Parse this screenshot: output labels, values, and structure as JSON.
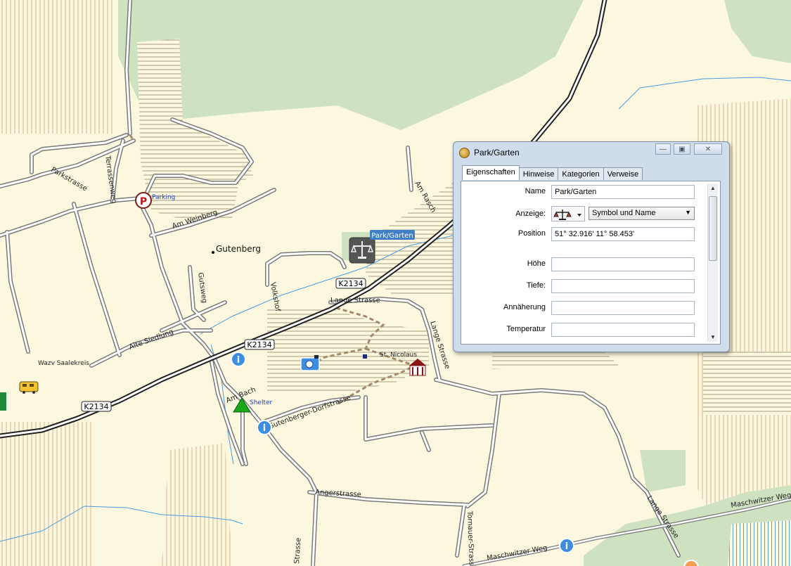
{
  "map": {
    "place_labels": {
      "gutenberg": "Gutenberg",
      "wazv": "Wazv Saalekreis",
      "parking": "Parking",
      "shelter": "Shelter",
      "st_nicolaus": "St. Nicolaus"
    },
    "street_labels": {
      "parkstrasse": "Parkstrasse",
      "terrassenweg": "Terrassenweg",
      "am_weinberg": "Am Weinberg",
      "gutsweg": "Gutsweg",
      "volkshof": "Volkshof",
      "alte_siedlung": "Alte Siedlung",
      "lange_strasse_1": "Lange Strasse",
      "lange_strasse_2": "Lange Strasse",
      "lange_strasse_3": "Lange Strasse",
      "am_rasch": "Am Rasch",
      "am_bach": "Am Bach",
      "gutenberger_dorfstrasse": "Gutenberger-Dorfstrasse",
      "angerstrasse": "Angerstrasse",
      "tornauer_strasse": "Tornauer-Strasse",
      "strasse_bottom": "Strasse",
      "maschwitzer_weg_1": "Maschwitzer Weg",
      "maschwitzer_weg_2": "Maschwitzer Weg"
    },
    "road_shields": [
      "K2134",
      "K2134",
      "K2134"
    ],
    "selected_poi_label": "Park/Garten",
    "colors": {
      "background": "#fbf8df",
      "forest": "#cfe2c0",
      "major_road": "#222222",
      "minor_road_outline": "#7a7a7a",
      "track": "#a4896a",
      "water": "#4a9de0",
      "selection_label": "#3f7fc8"
    }
  },
  "dialog": {
    "title": "Park/Garten",
    "title_icon": "app-globe-icon",
    "window_controls": [
      "minimize-icon",
      "restore-icon",
      "close-icon"
    ],
    "tabs": [
      "Eigenschaften",
      "Hinweise",
      "Kategorien",
      "Verweise"
    ],
    "active_tab": "Eigenschaften",
    "fields": {
      "name_label": "Name",
      "name_value": "Park/Garten",
      "anzeige_label": "Anzeige:",
      "anzeige_symbol": "scales-icon",
      "anzeige_value": "Symbol und Name",
      "position_label": "Position",
      "position_value": "51° 32.916' 11° 58.453'",
      "hoehe_label": "Höhe",
      "hoehe_value": "",
      "tiefe_label": "Tiefe:",
      "tiefe_value": "",
      "annaeherung_label": "Annäherung",
      "annaeherung_value": "",
      "temperatur_label": "Temperatur",
      "temperatur_value": ""
    }
  }
}
